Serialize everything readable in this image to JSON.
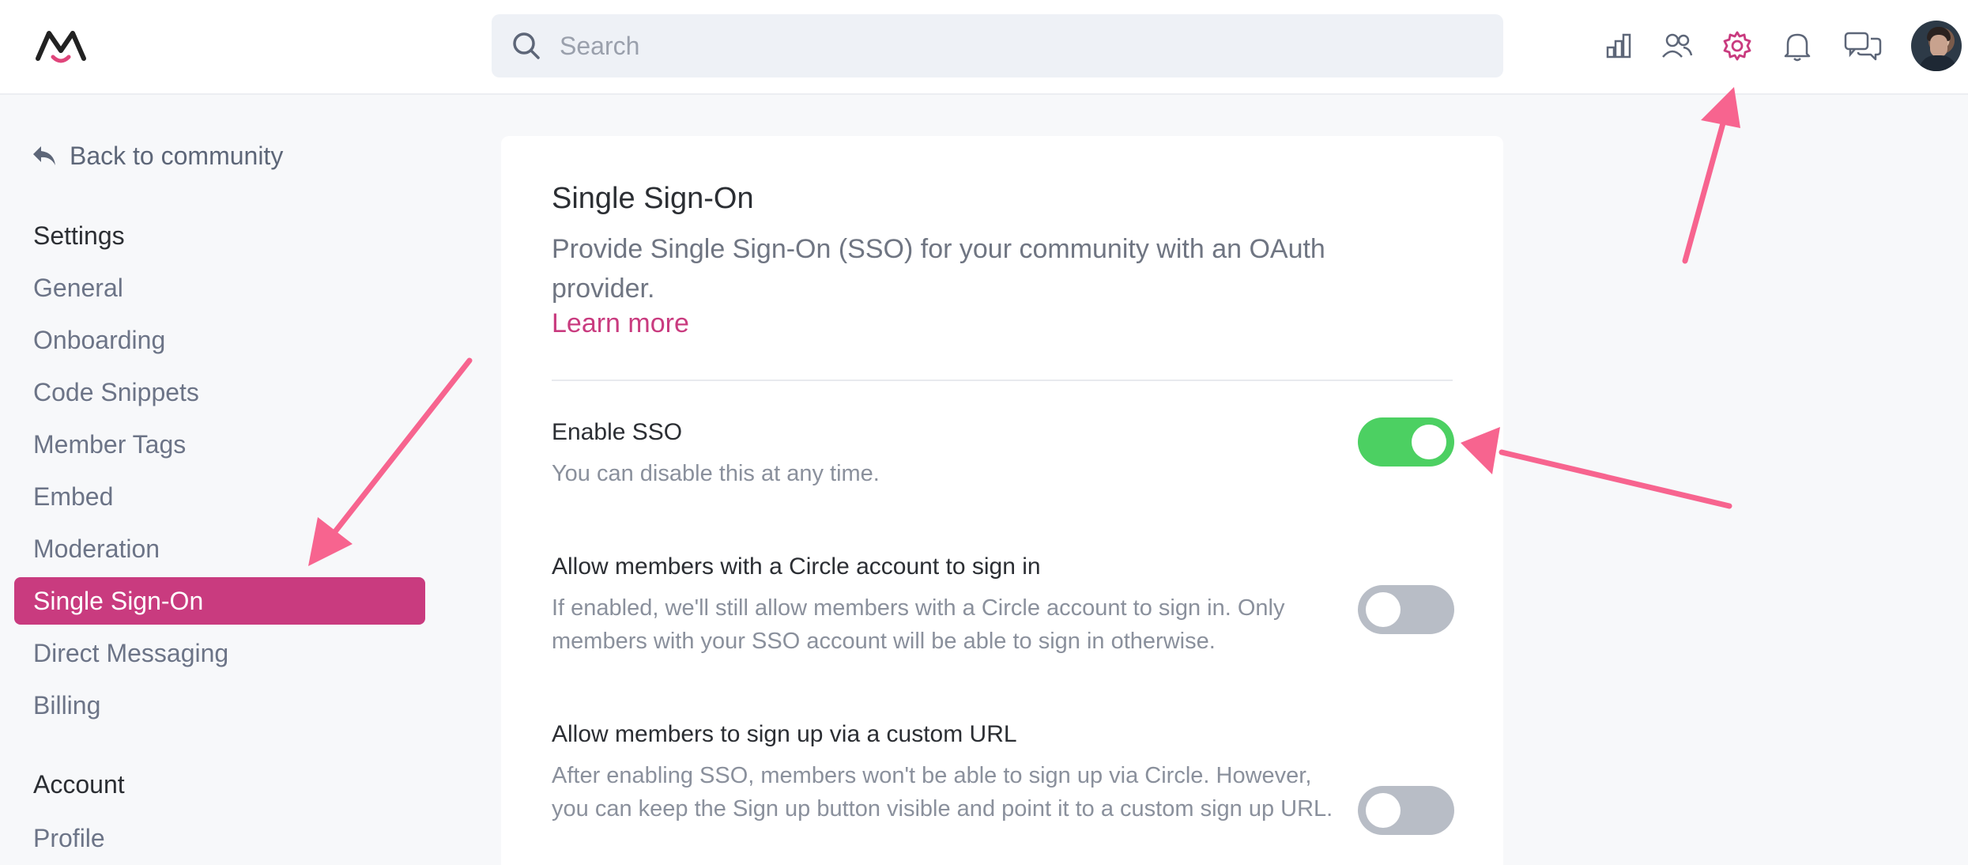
{
  "header": {
    "search_placeholder": "Search",
    "icons": [
      "logo-icon",
      "search-icon",
      "analytics-icon",
      "members-icon",
      "gear-icon",
      "bell-icon",
      "chat-bubbles-icon",
      "avatar"
    ],
    "accent_color": "#c93b7f"
  },
  "sidebar": {
    "back_label": "Back to community",
    "settings_title": "Settings",
    "settings_items": [
      {
        "label": "General"
      },
      {
        "label": "Onboarding"
      },
      {
        "label": "Code Snippets"
      },
      {
        "label": "Member Tags"
      },
      {
        "label": "Embed"
      },
      {
        "label": "Moderation"
      },
      {
        "label": "Single Sign-On",
        "active": true
      },
      {
        "label": "Direct Messaging"
      },
      {
        "label": "Billing"
      }
    ],
    "account_title": "Account",
    "account_items": [
      {
        "label": "Profile"
      }
    ]
  },
  "main": {
    "title": "Single Sign-On",
    "description": "Provide Single Sign-On (SSO) for your community with an OAuth provider.",
    "learn_more": "Learn more",
    "options": [
      {
        "title": "Enable SSO",
        "description": "You can disable this at any time.",
        "enabled": true
      },
      {
        "title": "Allow members with a Circle account to sign in",
        "description": "If enabled, we'll still allow members with a Circle account to sign in. Only members with your SSO account will be able to sign in otherwise.",
        "enabled": false
      },
      {
        "title": "Allow members to sign up via a custom URL",
        "description": "After enabling SSO, members won't be able to sign up via Circle. However, you can keep the Sign up button visible and point it to a custom sign up URL.",
        "enabled": false
      }
    ],
    "toggle_on_color": "#4cd062",
    "toggle_off_color": "#b8bdc6"
  },
  "annotations": {
    "arrow_color": "#f7648f"
  }
}
